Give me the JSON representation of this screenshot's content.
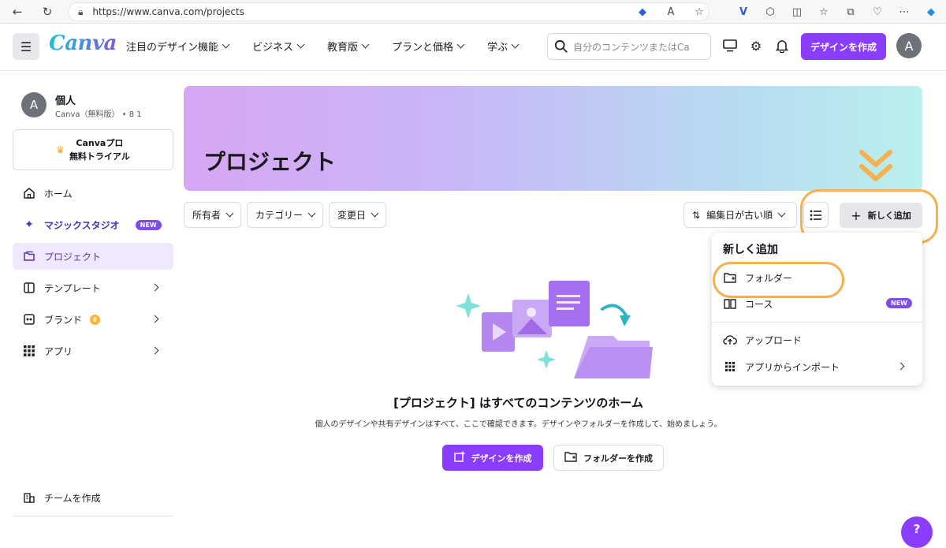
{
  "browser": {
    "url": "https://www.canva.com/projects",
    "back_icon": "arrow-left-icon",
    "reload_icon": "reload-icon"
  },
  "header": {
    "logo": "Canva",
    "nav": [
      {
        "label": "注目のデザイン機能"
      },
      {
        "label": "ビジネス"
      },
      {
        "label": "教育版"
      },
      {
        "label": "プランと価格"
      },
      {
        "label": "学ぶ"
      }
    ],
    "search_placeholder": "自分のコンテンツまたはCa",
    "create_label": "デザインを作成",
    "avatar_initial": "A"
  },
  "sidebar": {
    "account": {
      "initial": "A",
      "name": "個人",
      "sub": "Canva（無料版） • 8 1"
    },
    "pro_trial": {
      "line1": "Canvaプロ",
      "line2": "無料トライアル"
    },
    "items": [
      {
        "label": "ホーム"
      },
      {
        "label": "マジックスタジオ",
        "badge": "NEW"
      },
      {
        "label": "プロジェクト"
      },
      {
        "label": "テンプレート"
      },
      {
        "label": "ブランド"
      },
      {
        "label": "アプリ"
      }
    ],
    "create_team": "チームを作成"
  },
  "main": {
    "title": "プロジェクト",
    "filters": {
      "owner": "所有者",
      "category": "カテゴリー",
      "modified": "変更日",
      "sort": "編集日が古い順"
    },
    "add_new_label": "新しく追加",
    "dropdown": {
      "title": "新しく追加",
      "items": [
        {
          "label": "フォルダー"
        },
        {
          "label": "コース",
          "badge": "NEW"
        },
        {
          "label": "アップロード"
        },
        {
          "label": "アプリからインポート"
        }
      ]
    },
    "empty": {
      "title": "[プロジェクト] はすべてのコンテンツのホーム",
      "desc": "個人のデザインや共有デザインはすべて、ここで確認できます。デザインやフォルダーを作成して、始めましょう。",
      "primary": "デザインを作成",
      "secondary": "フォルダーを作成"
    },
    "help": "?"
  },
  "colors": {
    "accent": "#8b3dff",
    "highlight": "#f6b04f"
  }
}
